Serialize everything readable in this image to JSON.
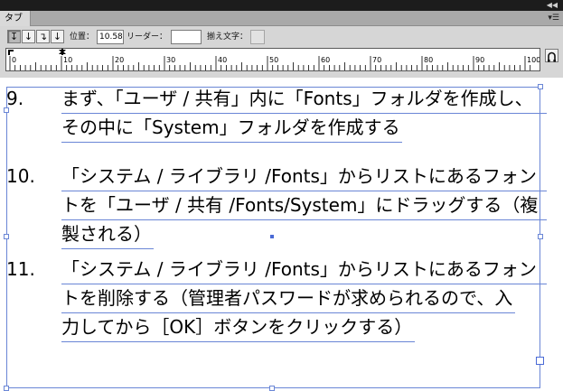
{
  "panel": {
    "tab_label": "タブ",
    "collapse_icon": "double-chevron-left-icon",
    "menu_icon": "panel-menu-icon",
    "tab_buttons": [
      {
        "name": "left-tab-button",
        "glyph": "↧",
        "active": true
      },
      {
        "name": "center-tab-button",
        "glyph": "↓",
        "active": false
      },
      {
        "name": "right-tab-button",
        "glyph": "↴",
        "active": false
      },
      {
        "name": "decimal-tab-button",
        "glyph": "↓",
        "active": false
      }
    ],
    "position_label": "位置：",
    "position_value": "10.58",
    "leader_label": "リーダー：",
    "leader_value": "",
    "align_label": "揃え文字：",
    "align_value": "",
    "ruler_labels": [
      "0",
      "10",
      "20",
      "30",
      "40",
      "50",
      "60",
      "70",
      "80",
      "90",
      "100"
    ],
    "colors": {
      "frame": "#6a86d6",
      "topbar": "#1c1c1c",
      "panel": "#d6d6d6"
    }
  },
  "document": {
    "items": [
      {
        "number": "9.",
        "lines": [
          "まず、「ユーザ / 共有」内に「Fonts」フォルダを作成し、",
          "その中に「System」フォルダを作成する"
        ]
      },
      {
        "number": "10.",
        "lines": [
          "「システム / ライブラリ /Fonts」からリストにあるフォン",
          "トを「ユーザ / 共有 /Fonts/System」にドラッグする（複",
          "製される）"
        ]
      },
      {
        "number": "11.",
        "lines": [
          "「システム / ライブラリ /Fonts」からリストにあるフォン",
          "トを削除する（管理者パスワードが求められるので、入",
          "力してから［OK］ボタンをクリックする）"
        ]
      }
    ]
  }
}
